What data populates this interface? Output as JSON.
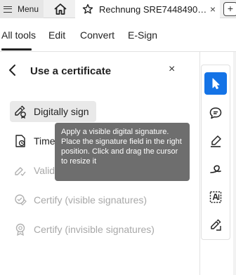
{
  "tabbar": {
    "menu_label": "Menu",
    "document_tab": "Rechnung SRE7448490…",
    "close_symbol": "×",
    "new_tab_symbol": "+"
  },
  "tool_tabs": [
    {
      "label": "All tools",
      "active": true
    },
    {
      "label": "Edit",
      "active": false
    },
    {
      "label": "Convert",
      "active": false
    },
    {
      "label": "E-Sign",
      "active": false
    }
  ],
  "panel": {
    "title": "Use a certificate",
    "close_symbol": "×",
    "items": [
      {
        "label": "Digitally sign",
        "icon": "digital-sign-icon",
        "disabled": false
      },
      {
        "label": "Times",
        "icon": "timestamp-icon",
        "disabled": false
      },
      {
        "label": "Valida",
        "icon": "validate-icon",
        "disabled": true
      },
      {
        "label": "Certify (visible signatures)",
        "icon": "certify-visible-icon",
        "disabled": true
      },
      {
        "label": "Certify (invisible signatures)",
        "icon": "certify-invisible-icon",
        "disabled": true
      }
    ]
  },
  "tooltip": {
    "text": "Apply a visible digital signature. Place the signature field in the right position. Click and drag the cursor to resize it"
  },
  "right_toolbar": {
    "tools": [
      "select-cursor-icon",
      "comment-icon",
      "highlight-pen-icon",
      "freehand-draw-icon",
      "text-select-icon",
      "sign-icon"
    ],
    "selected_index": 0,
    "accent_color": "#1473e6"
  }
}
